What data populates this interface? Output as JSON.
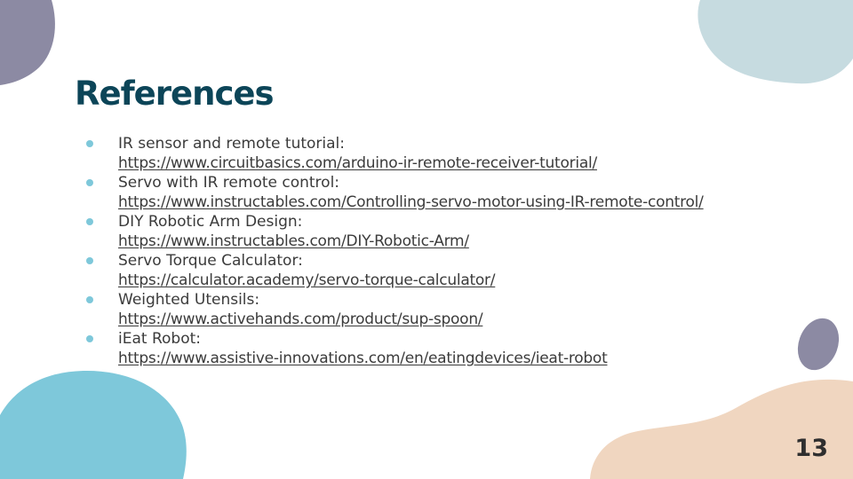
{
  "slide": {
    "title": "References",
    "page_number": "13",
    "accent_colors": {
      "title": "#0c4558",
      "bullet": "#7ec8da",
      "blob_purple": "#8c8aa3",
      "blob_light_blue": "#c6dbe0",
      "blob_teal": "#7ec8da",
      "blob_peach": "#f0d6c0"
    }
  },
  "references": [
    {
      "label": "IR sensor and remote tutorial:",
      "url": "https://www.circuitbasics.com/arduino-ir-remote-receiver-tutorial/"
    },
    {
      "label": "Servo with IR remote control:",
      "url": "https://www.instructables.com/Controlling-servo-motor-using-IR-remote-control/"
    },
    {
      "label": "DIY Robotic Arm Design:",
      "url": "https://www.instructables.com/DIY-Robotic-Arm/"
    },
    {
      "label": "Servo Torque Calculator:",
      "url": "https://calculator.academy/servo-torque-calculator/"
    },
    {
      "label": "Weighted Utensils:",
      "url": "https://www.activehands.com/product/sup-spoon/"
    },
    {
      "label": "iEat Robot:",
      "url": "https://www.assistive-innovations.com/en/eatingdevices/ieat-robot"
    }
  ]
}
